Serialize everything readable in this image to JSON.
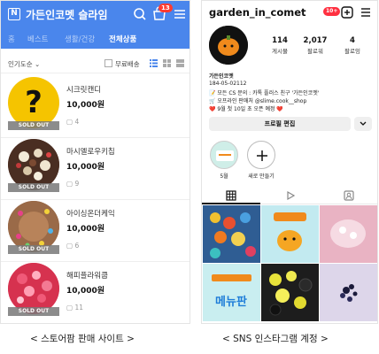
{
  "store": {
    "logo": "N",
    "title": "가든인코멧 슬라임",
    "cart_count": "13",
    "tabs": [
      {
        "label": "홈"
      },
      {
        "label": "베스트"
      },
      {
        "label": "생활/건강"
      },
      {
        "label": "전체상품"
      }
    ],
    "sort_label": "인기도순 ⌄",
    "free_shipping_label": "무료배송",
    "products": [
      {
        "name": "시크릿캔디",
        "price": "10,000원",
        "comments": "4",
        "badge": "SOLD OUT"
      },
      {
        "name": "마시멜로우키칩",
        "price": "10,000원",
        "comments": "9",
        "badge": "SOLD OUT"
      },
      {
        "name": "아이싱온더케익",
        "price": "10,000원",
        "comments": "6",
        "badge": "SOLD OUT"
      },
      {
        "name": "해피플라워쿱",
        "price": "10,000원",
        "comments": "11",
        "badge": "SOLD OUT"
      }
    ],
    "caption": "< 스토어팜 판매 사이트 >"
  },
  "instagram": {
    "username": "garden_in_comet",
    "notif_badge": "10+",
    "stats": [
      {
        "value": "114",
        "label": "게시물"
      },
      {
        "value": "2,017",
        "label": "팔로워"
      },
      {
        "value": "4",
        "label": "팔로잉"
      }
    ],
    "bio": {
      "name": "가든인코멧",
      "line1": "184-05-02112",
      "line2": "📝 모든 CS 문의 : 카톡 플러스 친구 '가든인코멧'",
      "line3": "🛒 오프라인 판매처 @slime.cook__shop",
      "line4": "❤️ 9월 첫 10일 초 오픈 예정 ❤️"
    },
    "edit_profile": "프로필 편집",
    "highlights": [
      {
        "label": "5월"
      },
      {
        "label": "새로 만들기"
      }
    ],
    "grid_menu_text": "메뉴판",
    "caption": "< SNS 인스타그램 계정 >"
  }
}
